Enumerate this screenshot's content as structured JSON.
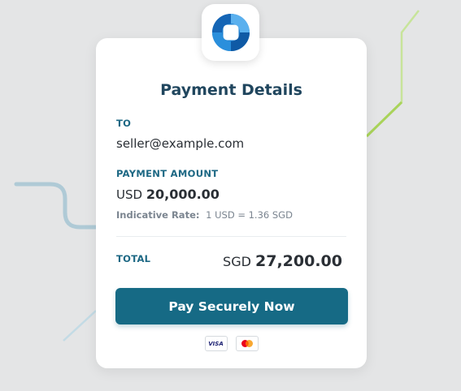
{
  "title": "Payment Details",
  "recipient": {
    "label": "TO",
    "value": "seller@example.com"
  },
  "payment_amount": {
    "label": "PAYMENT AMOUNT",
    "currency": "USD",
    "amount": "20,000.00",
    "rate_label": "Indicative Rate:",
    "rate_value": "1 USD = 1.36 SGD"
  },
  "total": {
    "label": "TOTAL",
    "currency": "SGD",
    "amount": "27,200.00"
  },
  "pay_button": {
    "label": "Pay Securely Now"
  },
  "payment_methods": [
    {
      "name": "visa-icon",
      "label": "VISA"
    },
    {
      "name": "mastercard-icon"
    }
  ],
  "colors": {
    "accent": "#166a85",
    "heading": "#20465e",
    "label": "#1d6884",
    "background": "#e4e5e6"
  }
}
